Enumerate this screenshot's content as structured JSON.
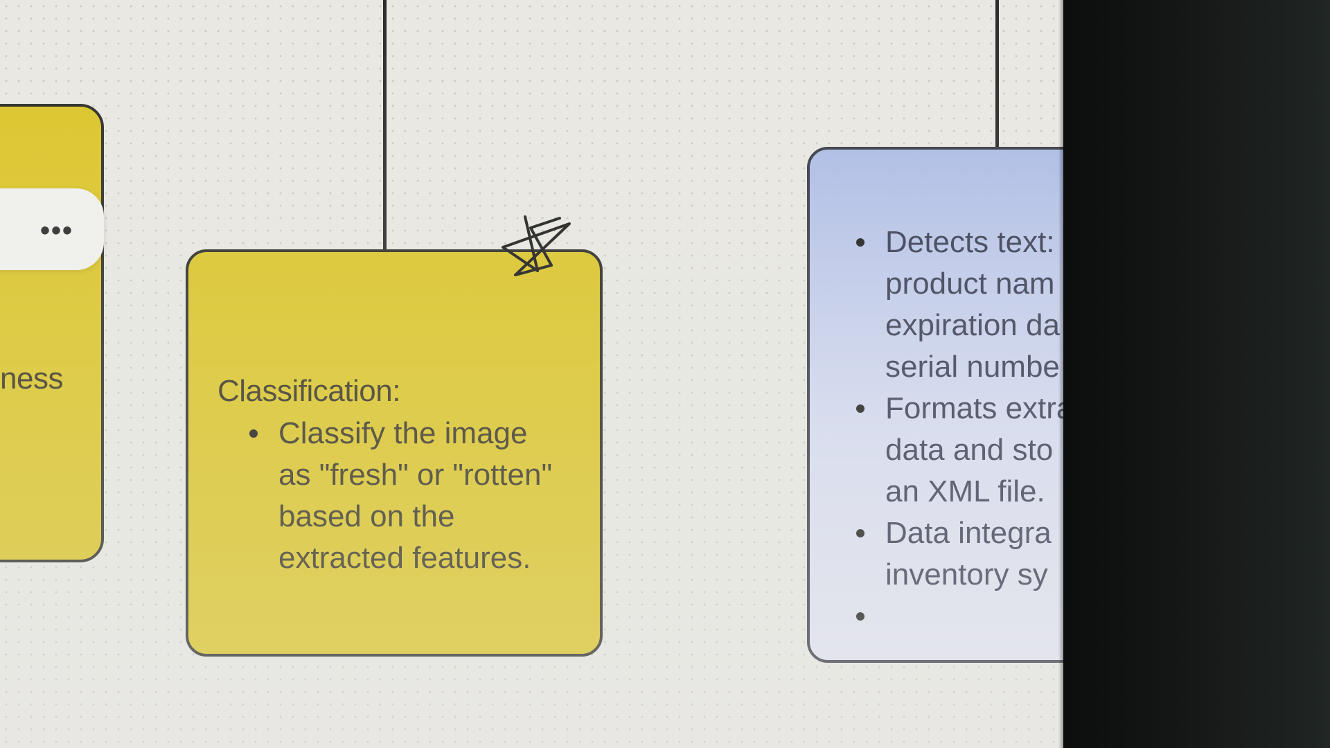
{
  "canvas": {
    "background": "#e9e8e3",
    "accent_yellow": "#dcc62a",
    "accent_blue": "#aebde6"
  },
  "left_node": {
    "partial_label": "ness"
  },
  "menu": {
    "icon": "more-horizontal-icon",
    "dots": "•••"
  },
  "classification_node": {
    "title": "Classification:",
    "bullets": [
      "Classify the image",
      "as \"fresh\" or \"rotten\"",
      "based on the",
      "extracted features."
    ],
    "corner_icon": "star-icon"
  },
  "ocr_node": {
    "lines": [
      {
        "text": "Detects text:",
        "bullet": true
      },
      {
        "text": "product nam",
        "bullet": false
      },
      {
        "text": "expiration da",
        "bullet": false
      },
      {
        "text": "serial numbe",
        "bullet": false
      },
      {
        "text": "Formats extra",
        "bullet": true
      },
      {
        "text": "data and sto",
        "bullet": false
      },
      {
        "text": "an XML file.",
        "bullet": false
      },
      {
        "text": "Data integra",
        "bullet": true
      },
      {
        "text": "inventory sy",
        "bullet": false
      },
      {
        "text": "",
        "bullet": true
      }
    ]
  }
}
